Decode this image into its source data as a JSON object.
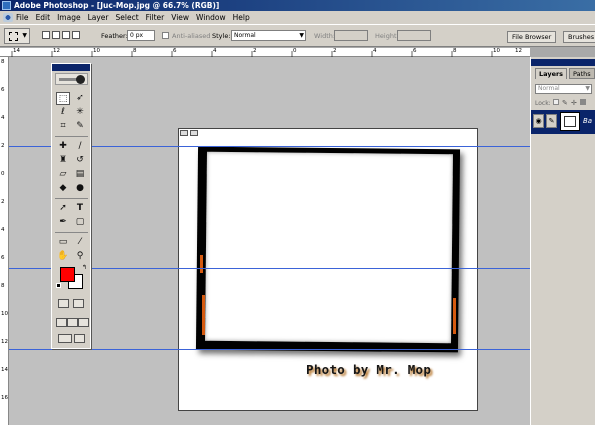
{
  "window": {
    "title": "Adobe Photoshop - [Juc-Mop.jpg @ 66.7% (RGB)]"
  },
  "menu": [
    "File",
    "Edit",
    "Image",
    "Layer",
    "Select",
    "Filter",
    "View",
    "Window",
    "Help"
  ],
  "options_bar": {
    "feather_label": "Feather:",
    "feather_value": "0 px",
    "antialiased_label": "Anti-aliased",
    "style_label": "Style:",
    "style_value": "Normal",
    "width_label": "Width:",
    "height_label": "Height:"
  },
  "palette_well": {
    "tabs": [
      "File Browser",
      "Brushes"
    ]
  },
  "rulers": {
    "horizontal": [
      "14",
      "12",
      "10",
      "8",
      "6",
      "4",
      "2",
      "0",
      "2",
      "4",
      "6",
      "8",
      "10",
      "12"
    ],
    "vertical": [
      "8",
      "6",
      "4",
      "2",
      "0",
      "2",
      "4",
      "6",
      "8",
      "10",
      "12",
      "14",
      "16"
    ]
  },
  "canvas": {
    "caption": "Photo by Mr. Mop"
  },
  "toolbox": {
    "foreground_color": "#ff0000",
    "background_color": "#ffffff",
    "tools": [
      "rect-marquee",
      "move",
      "lasso",
      "magic-wand",
      "crop",
      "slice",
      "healing-brush",
      "brush",
      "clone-stamp",
      "history-brush",
      "eraser",
      "gradient",
      "blur",
      "dodge",
      "path-select",
      "type",
      "pen",
      "shape",
      "notes",
      "eyedropper",
      "hand",
      "zoom"
    ]
  },
  "layers_panel": {
    "tabs": [
      "Layers",
      "Paths"
    ],
    "blend_mode": "Normal",
    "lock_label": "Lock:",
    "layer_name": "Ba"
  },
  "guides_color": "#3b63d8"
}
